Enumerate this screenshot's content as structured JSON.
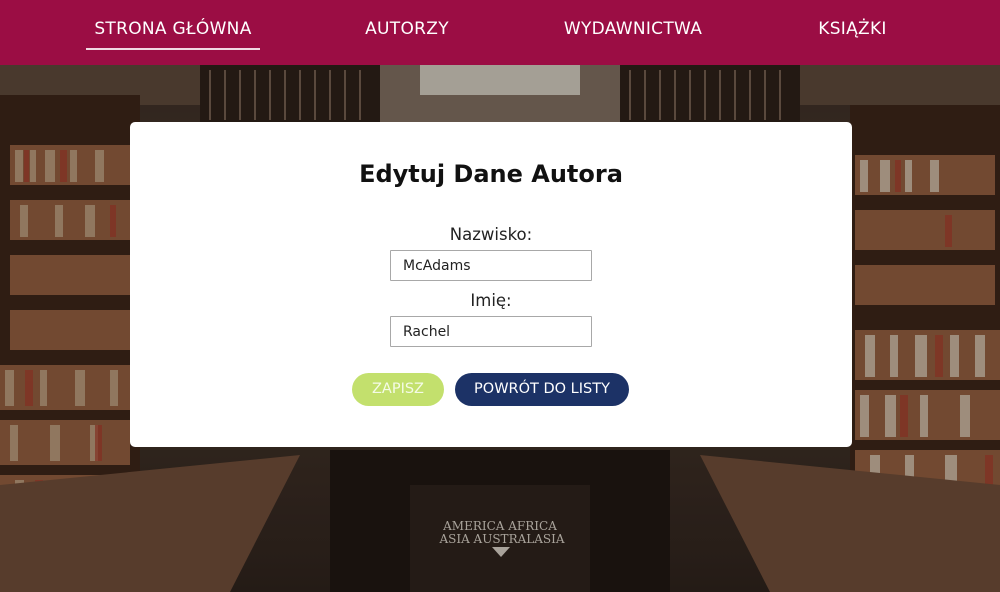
{
  "nav": {
    "items": [
      {
        "label": "STRONA GŁÓWNA",
        "active": true
      },
      {
        "label": "AUTORZY",
        "active": false
      },
      {
        "label": "WYDAWNICTWA",
        "active": false
      },
      {
        "label": "KSIĄŻKI",
        "active": false
      }
    ]
  },
  "background": {
    "sign_line1": "AMERICA   AFRICA",
    "sign_line2": "ASIA   AUSTRALASIA"
  },
  "form": {
    "title": "Edytuj Dane Autora",
    "surname_label": "Nazwisko:",
    "surname_value": "McAdams",
    "firstname_label": "Imię:",
    "firstname_value": "Rachel",
    "save_label": "ZAPISZ",
    "back_label": "POWRÓT DO LISTY"
  },
  "colors": {
    "navbar": "#9b0d44",
    "save_button": "#c3e06d",
    "back_button": "#1c3266"
  }
}
